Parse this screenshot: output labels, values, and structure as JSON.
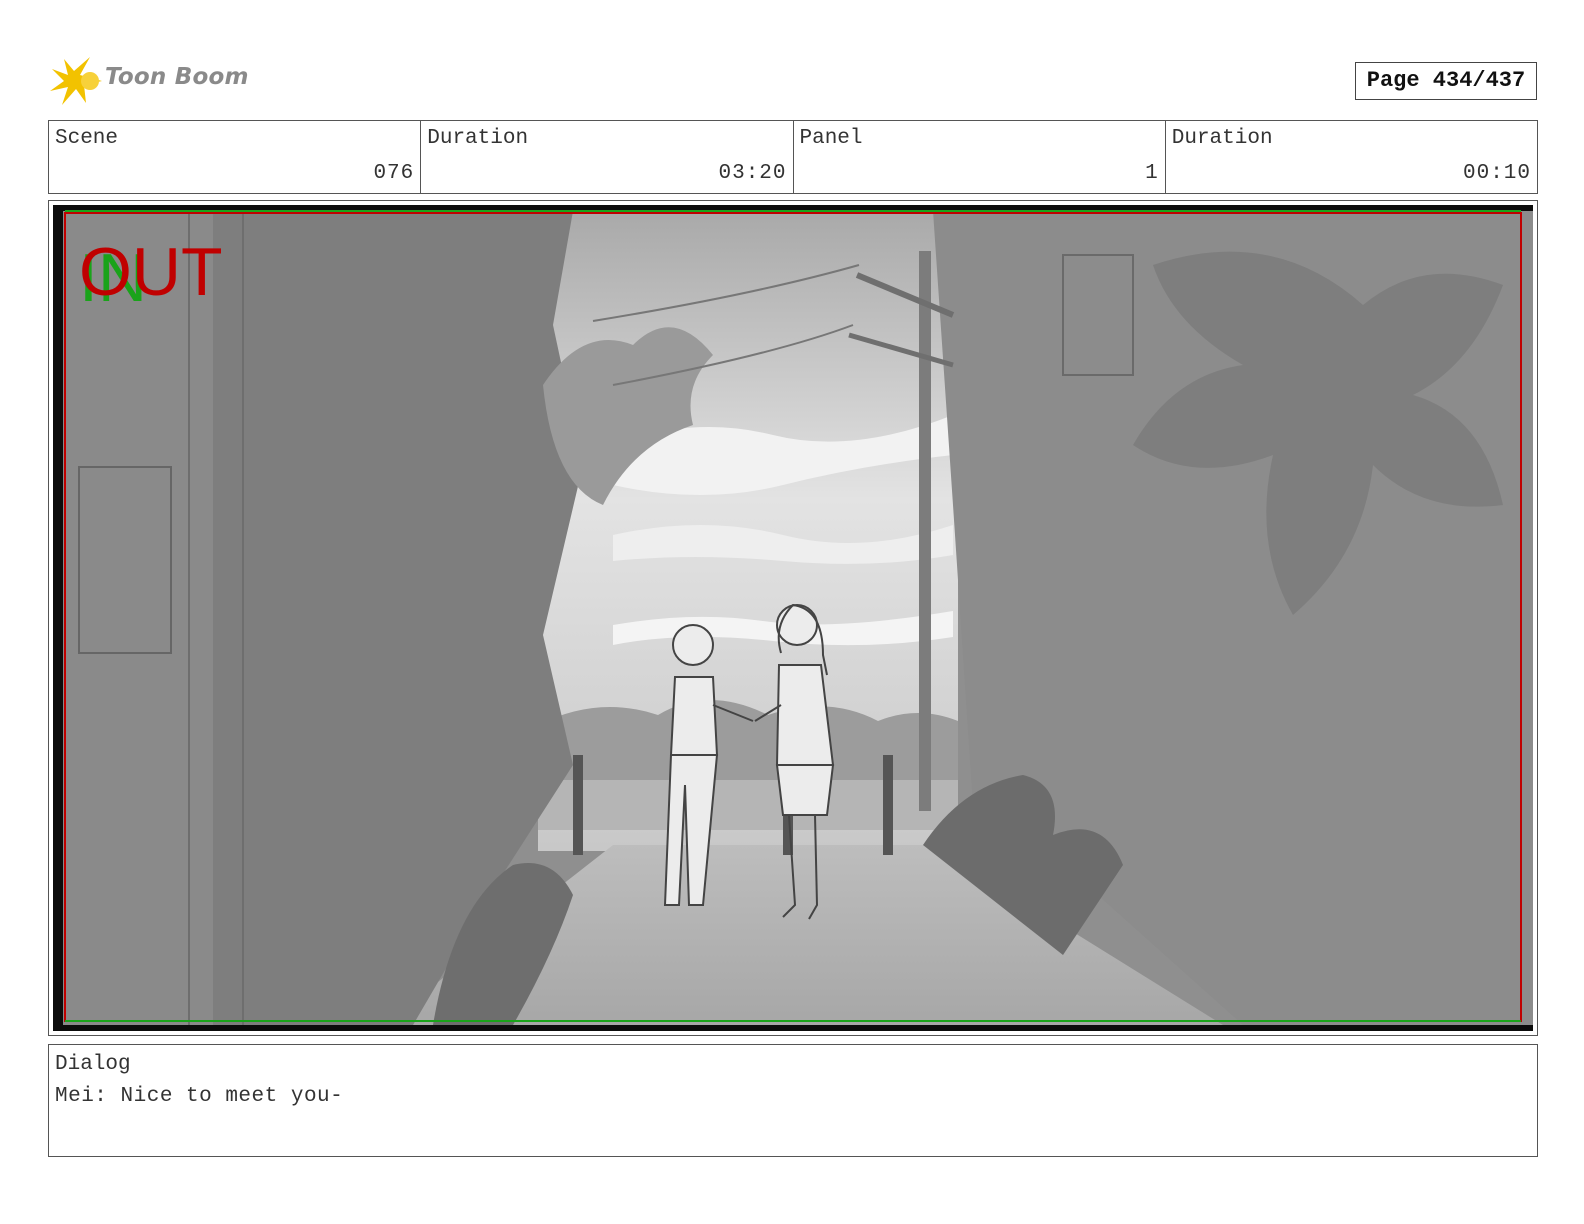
{
  "logo": {
    "name": "Toon Boom",
    "icon": "starburst-logo-icon",
    "color": "#f2c200"
  },
  "page": {
    "label": "Page 434/437"
  },
  "header": {
    "scene_label": "Scene",
    "scene_value": "076",
    "duration_label": "Duration",
    "duration_value": "03:20",
    "panel_label": "Panel",
    "panel_value": "1",
    "panel_duration_label": "Duration",
    "panel_duration_value": "00:10"
  },
  "frame": {
    "in_marker": "IN",
    "in_color": "#1aa31a",
    "out_marker": "OUT",
    "out_color": "#c00000",
    "safe_area_colors": [
      "#c00000",
      "#1aa31a"
    ]
  },
  "dialog": {
    "label": "Dialog",
    "text": "Mei: Nice to meet you-"
  }
}
